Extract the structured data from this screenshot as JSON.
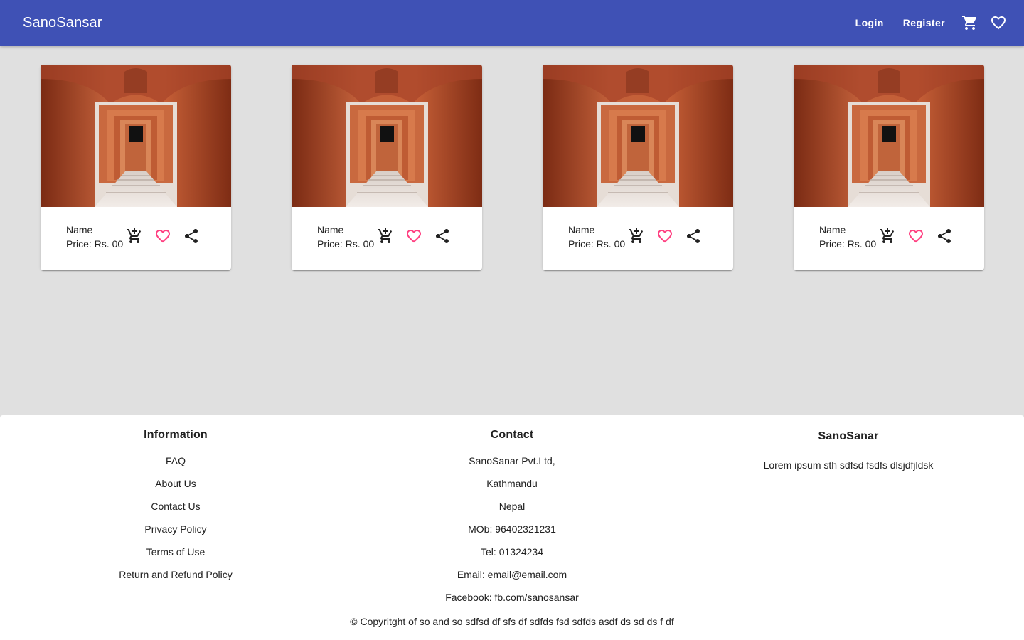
{
  "header": {
    "brand": "SanoSansar",
    "login_label": "Login",
    "register_label": "Register",
    "cart_icon": "shopping-cart-icon",
    "wishlist_icon": "heart-outline-icon"
  },
  "colors": {
    "appbar": "#3f51b5",
    "page_background": "#e0e0e0",
    "favorite_icon": "#ff4081"
  },
  "products": [
    {
      "name": "Name",
      "price": "Price: Rs. 00"
    },
    {
      "name": "Name",
      "price": "Price: Rs. 00"
    },
    {
      "name": "Name",
      "price": "Price: Rs. 00"
    },
    {
      "name": "Name",
      "price": "Price: Rs. 00"
    }
  ],
  "footer": {
    "information": {
      "title": "Information",
      "links": [
        "FAQ",
        "About Us",
        "Contact Us",
        "Privacy Policy",
        "Terms of Use",
        "Return and Refund Policy"
      ]
    },
    "contact": {
      "title": "Contact",
      "lines": [
        "SanoSanar Pvt.Ltd,",
        "Kathmandu",
        "Nepal",
        "MOb: 96402321231",
        "Tel: 01324234",
        "Email: email@email.com",
        "Facebook: fb.com/sanosansar"
      ]
    },
    "about": {
      "title": "SanoSanar",
      "text": "Lorem ipsum sth sdfsd fsdfs dlsjdfjldsk"
    },
    "copyright": "© Copyritght of so and so sdfsd df sfs df sdfds fsd sdfds asdf ds sd ds f df"
  }
}
